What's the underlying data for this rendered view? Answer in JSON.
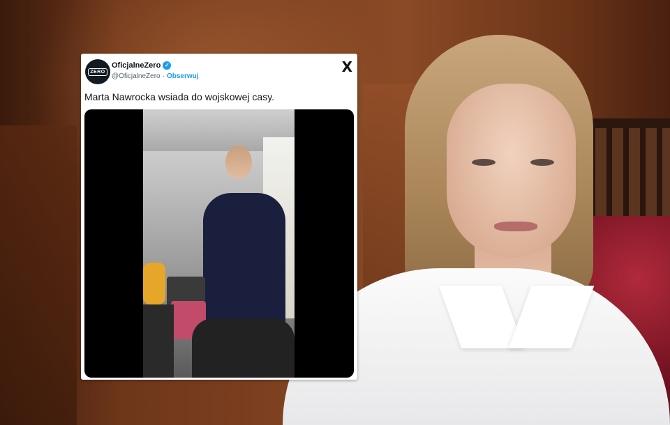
{
  "tweet": {
    "avatar_text": "ZERO",
    "display_name": "OficjalneZero",
    "verified_icon": "verified-badge-icon",
    "handle": "@OficjalneZero",
    "separator": "·",
    "follow_label": "Obserwuj",
    "platform_logo": "X",
    "text": "Marta Nawrocka wsiada do wojskowej casy."
  },
  "colors": {
    "follow_link": "#1d9bf0",
    "verified_badge": "#1d9bf0",
    "text_primary": "#0f1419",
    "text_secondary": "#536471"
  }
}
